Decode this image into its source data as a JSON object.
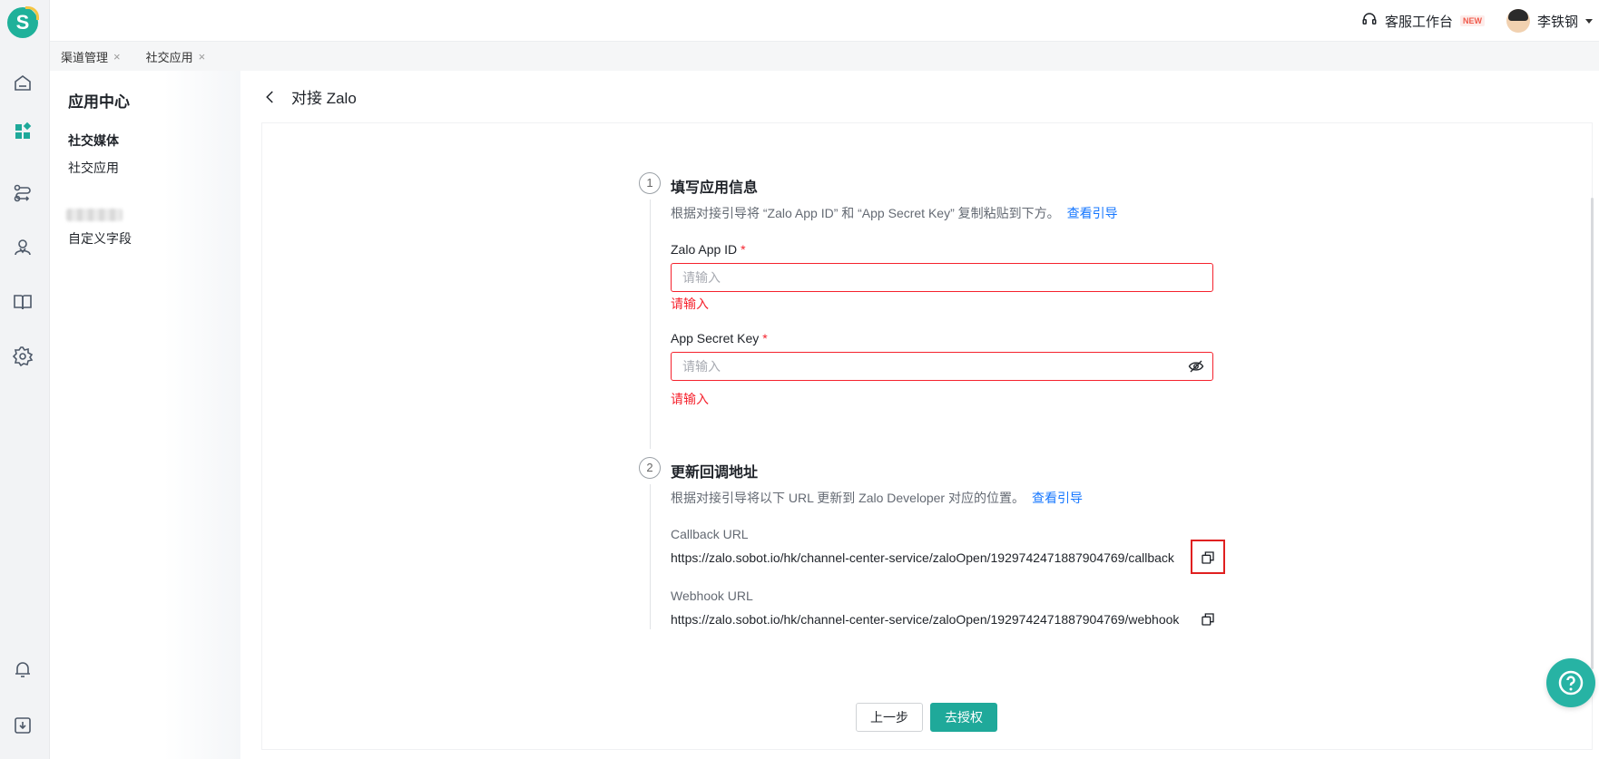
{
  "app": {
    "logo_letter": "S"
  },
  "topbar": {
    "workspace_label": "客服工作台",
    "workspace_badge": "NEW",
    "user_name": "李铁钢"
  },
  "tabs": [
    {
      "label": "渠道管理",
      "close": "×"
    },
    {
      "label": "社交应用",
      "close": "×"
    }
  ],
  "sidebar": {
    "title": "应用中心",
    "group": "社交媒体",
    "items": [
      "社交应用",
      "自定义字段"
    ]
  },
  "page": {
    "title": "对接 Zalo"
  },
  "step1": {
    "number": "1",
    "title": "填写应用信息",
    "desc": "根据对接引导将 “Zalo App ID” 和 “App Secret Key” 复制粘贴到下方。",
    "guide_link": "查看引导",
    "app_id": {
      "label": "Zalo App ID",
      "required": "*",
      "value": "",
      "placeholder": "请输入",
      "error": "请输入"
    },
    "secret": {
      "label": "App Secret Key",
      "required": "*",
      "value": "",
      "placeholder": "请输入",
      "error": "请输入"
    }
  },
  "step2": {
    "number": "2",
    "title": "更新回调地址",
    "desc": "根据对接引导将以下 URL 更新到 Zalo Developer 对应的位置。",
    "guide_link": "查看引导",
    "callback": {
      "label": "Callback URL",
      "value": "https://zalo.sobot.io/hk/channel-center-service/zaloOpen/1929742471887904769/callback"
    },
    "webhook": {
      "label": "Webhook URL",
      "value": "https://zalo.sobot.io/hk/channel-center-service/zaloOpen/1929742471887904769/webhook"
    }
  },
  "buttons": {
    "prev": "上一步",
    "authorize": "去授权"
  },
  "icons": {
    "rail": [
      "home-icon",
      "apps-icon",
      "route-icon",
      "user-group-icon",
      "book-icon",
      "gear-icon",
      "bell-icon",
      "download-icon"
    ],
    "accent": "#1fa99a",
    "error": "#f5222d",
    "link": "#1677ff"
  }
}
